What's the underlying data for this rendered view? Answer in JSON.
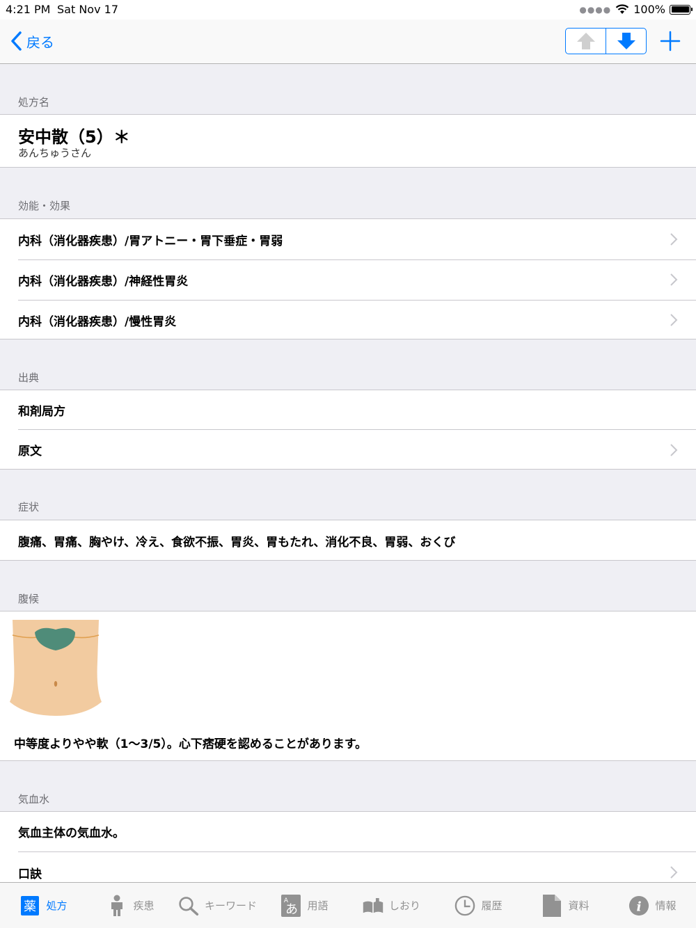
{
  "status": {
    "time": "4:21 PM",
    "date": "Sat Nov 17",
    "battery": "100%"
  },
  "nav": {
    "back_label": "戻る"
  },
  "prescription": {
    "header": "処方名",
    "name": "安中散（5）＊",
    "reading": "あんちゅうさん"
  },
  "efficacy": {
    "header": "効能・効果",
    "items": [
      "内科（消化器疾患）/胃アトニー・胃下垂症・胃弱",
      "内科（消化器疾患）/神経性胃炎",
      "内科（消化器疾患）/慢性胃炎"
    ]
  },
  "source": {
    "header": "出典",
    "book": "和剤局方",
    "original_text": "原文"
  },
  "symptoms": {
    "header": "症状",
    "text": "腹痛、胃痛、胸やけ、冷え、食欲不振、胃炎、胃もたれ、消化不良、胃弱、おくび"
  },
  "abdominal": {
    "header": "腹候",
    "text": "中等度よりやや軟（1～3/5）。心下痞硬を認めることがあります。"
  },
  "kiketsusui": {
    "header": "気血水",
    "text": "気血主体の気血水。",
    "kuketsu": "口訣"
  },
  "tabs": [
    {
      "label": "処方",
      "icon": "medicine-icon",
      "active": true
    },
    {
      "label": "疾患",
      "icon": "person-icon"
    },
    {
      "label": "キーワード",
      "icon": "search-icon"
    },
    {
      "label": "用語",
      "icon": "glossary-icon"
    },
    {
      "label": "しおり",
      "icon": "bookmark-icon"
    },
    {
      "label": "履歴",
      "icon": "clock-icon"
    },
    {
      "label": "資料",
      "icon": "document-icon"
    },
    {
      "label": "情報",
      "icon": "info-icon"
    }
  ],
  "colors": {
    "accent": "#007aff",
    "inactive": "#929292",
    "belly": "#f2cba0",
    "stomach_mark": "#4f8c79"
  }
}
